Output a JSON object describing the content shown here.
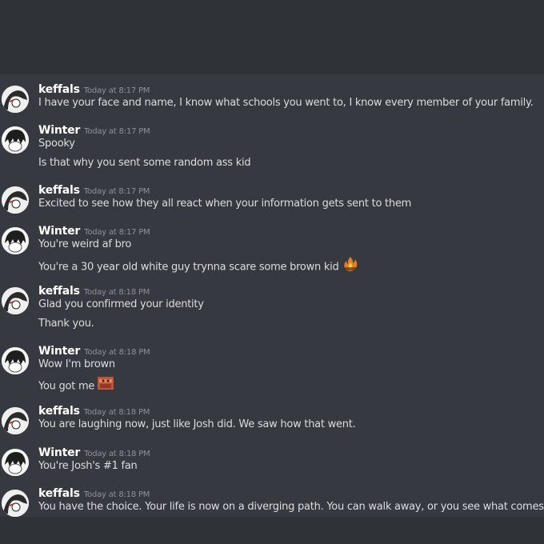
{
  "messages": [
    {
      "user": "keffals",
      "avatar": "keffals-avatar",
      "time": "Today at 8:17 PM",
      "lines": [
        "I have your face and name, I know what schools you went to, I know every member of your family."
      ]
    },
    {
      "user": "Winter",
      "avatar": "winter-avatar",
      "time": "Today at 8:17 PM",
      "lines": [
        "Spooky",
        "Is that why you sent some random ass kid"
      ]
    },
    {
      "user": "keffals",
      "avatar": "keffals-avatar",
      "time": "Today at 8:17 PM",
      "lines": [
        "Excited to see how they all react when your information gets sent to them"
      ]
    },
    {
      "user": "Winter",
      "avatar": "winter-avatar",
      "time": "Today at 8:17 PM",
      "lines": [
        "You're weird af bro",
        "You're a 30 year old white guy trynna scare some brown kid"
      ]
    },
    {
      "user": "keffals",
      "avatar": "keffals-avatar",
      "time": "Today at 8:18 PM",
      "lines": [
        "Glad you confirmed your identity",
        "Thank you."
      ]
    },
    {
      "user": "Winter",
      "avatar": "winter-avatar",
      "time": "Today at 8:18 PM",
      "lines": [
        "Wow I'm brown",
        "You got me"
      ]
    },
    {
      "user": "keffals",
      "avatar": "keffals-avatar",
      "time": "Today at 8:18 PM",
      "lines": [
        "You are laughing now, just like Josh did. We saw how that went."
      ]
    },
    {
      "user": "Winter",
      "avatar": "winter-avatar",
      "time": "Today at 8:18 PM",
      "lines": [
        "You're Josh's #1 fan"
      ]
    },
    {
      "user": "keffals",
      "avatar": "keffals-avatar",
      "time": "Today at 8:18 PM",
      "lines": [
        "You have the choice. Your life is now on a diverging path. You can walk away, or you see what comes next."
      ]
    }
  ],
  "emojis": {
    "msg3_line1": "fire-emoji",
    "msg5_line1": "custom-emoji"
  }
}
